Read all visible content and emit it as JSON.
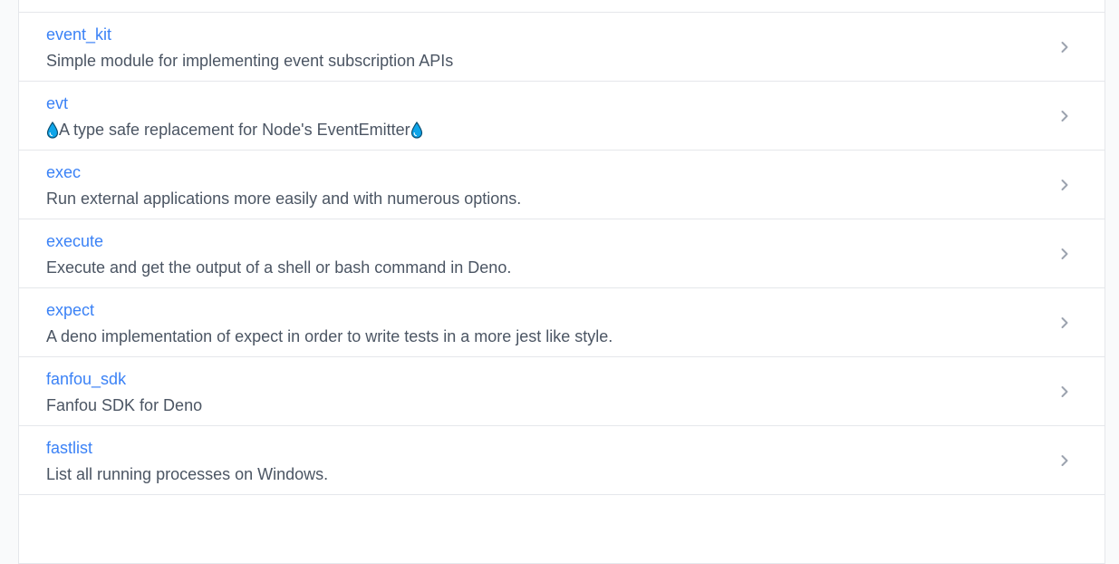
{
  "packages": [
    {
      "name": "",
      "description": "",
      "partial": true
    },
    {
      "name": "event_kit",
      "description": "Simple module for implementing event subscription APIs"
    },
    {
      "name": "evt",
      "description_prefix_icon": "water-drop-icon",
      "description": "A type safe replacement for Node's EventEmitter",
      "description_suffix_icon": "water-drop-icon"
    },
    {
      "name": "exec",
      "description": "Run external applications more easily and with numerous options."
    },
    {
      "name": "execute",
      "description": "Execute and get the output of a shell or bash command in Deno."
    },
    {
      "name": "expect",
      "description": "A deno implementation of expect in order to write tests in a more jest like style."
    },
    {
      "name": "fanfou_sdk",
      "description": "Fanfou SDK for Deno"
    },
    {
      "name": "fastlist",
      "description": "List all running processes on Windows."
    },
    {
      "name": "",
      "description": "",
      "partial": true
    }
  ],
  "colors": {
    "link": "#3b82f6",
    "description": "#4b5563",
    "chevron": "#9ca3af",
    "divider": "#e5e7eb",
    "drop": "#0ea5e9"
  },
  "icons": {
    "row_chevron": "chevron-right-icon"
  }
}
